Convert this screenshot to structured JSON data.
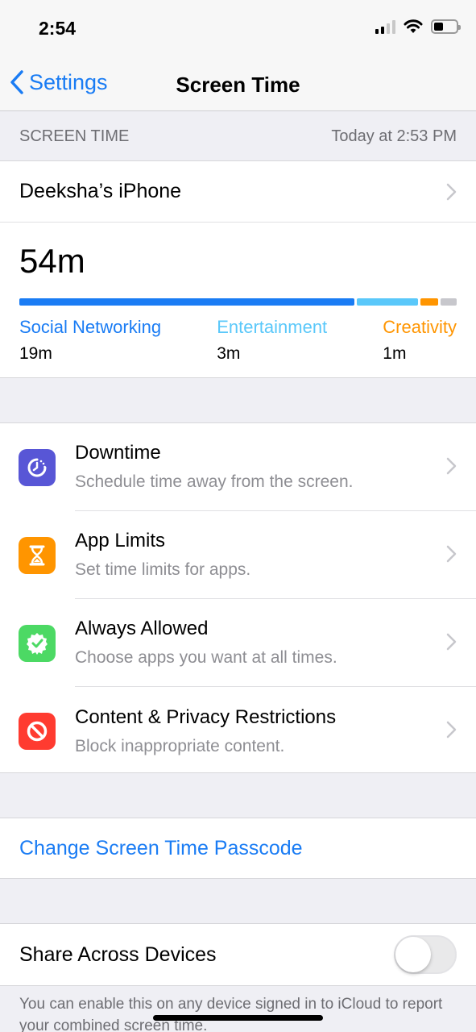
{
  "status": {
    "time": "2:54"
  },
  "nav": {
    "back_label": "Settings",
    "title": "Screen Time"
  },
  "section": {
    "label": "SCREEN TIME",
    "updated": "Today at 2:53 PM"
  },
  "device": {
    "name": "Deeksha’s iPhone"
  },
  "usage": {
    "total": "54m",
    "categories": [
      {
        "label": "Social Networking",
        "time": "19m",
        "color": "#1a7cf4"
      },
      {
        "label": "Entertainment",
        "time": "3m",
        "color": "#5ac8fa"
      },
      {
        "label": "Creativity",
        "time": "1m",
        "color": "#ff9500"
      }
    ],
    "other_color": "#c7c7cc"
  },
  "menu": [
    {
      "title": "Downtime",
      "subtitle": "Schedule time away from the screen.",
      "color": "#5856d6",
      "icon": "downtime-icon"
    },
    {
      "title": "App Limits",
      "subtitle": "Set time limits for apps.",
      "color": "#ff9500",
      "icon": "hourglass-icon"
    },
    {
      "title": "Always Allowed",
      "subtitle": "Choose apps you want at all times.",
      "color": "#4cd964",
      "icon": "checkmark-badge-icon"
    },
    {
      "title": "Content & Privacy Restrictions",
      "subtitle": "Block inappropriate content.",
      "color": "#ff3b30",
      "icon": "restriction-icon"
    }
  ],
  "passcode": {
    "label": "Change Screen Time Passcode"
  },
  "share": {
    "label": "Share Across Devices",
    "enabled": false
  },
  "footer": {
    "note": "You can enable this on any device signed in to iCloud to report your combined screen time."
  }
}
